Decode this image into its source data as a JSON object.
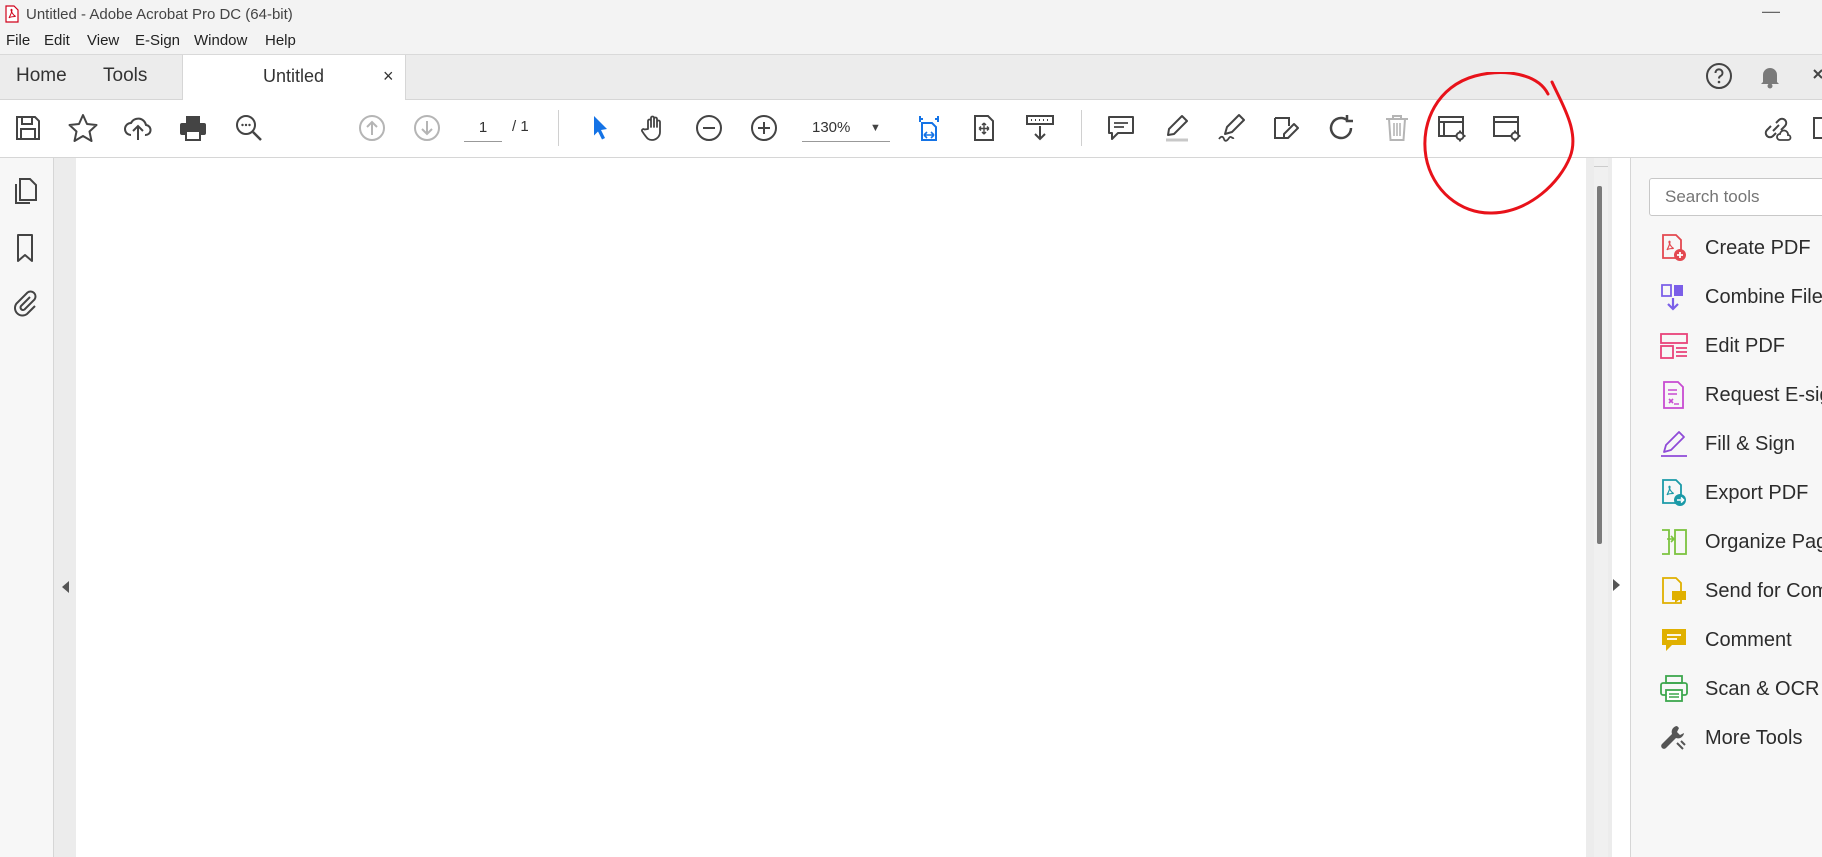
{
  "window": {
    "title": "Untitled - Adobe Acrobat Pro DC (64-bit)",
    "minimize_glyph": "—"
  },
  "menu": [
    "File",
    "Edit",
    "View",
    "E-Sign",
    "Window",
    "Help"
  ],
  "tabs": {
    "home": "Home",
    "tools": "Tools",
    "document": "Untitled",
    "close_glyph": "×"
  },
  "header_icons": [
    "help-icon",
    "notification-bell-icon"
  ],
  "toolbar": {
    "page_current": "1",
    "page_count": "/ 1",
    "zoom": "130%",
    "zoom_dropdown_glyph": "▼",
    "accent_color": "#1473e6"
  },
  "left_rail": [
    "page-thumbnails-icon",
    "bookmarks-icon",
    "attachments-icon"
  ],
  "right_panel": {
    "search_placeholder": "Search tools",
    "tools": [
      {
        "label": "Create PDF",
        "icon": "create-pdf-icon",
        "color": "#e34850"
      },
      {
        "label": "Combine Files",
        "icon": "combine-files-icon",
        "color": "#7b5fe8"
      },
      {
        "label": "Edit PDF",
        "icon": "edit-pdf-icon",
        "color": "#e8437a"
      },
      {
        "label": "Request E-signatures",
        "icon": "request-esign-icon",
        "color": "#c74bd1"
      },
      {
        "label": "Fill & Sign",
        "icon": "fill-sign-icon",
        "color": "#8f4bd8"
      },
      {
        "label": "Export PDF",
        "icon": "export-pdf-icon",
        "color": "#1b9aa8"
      },
      {
        "label": "Organize Pages",
        "icon": "organize-pages-icon",
        "color": "#7cc33f"
      },
      {
        "label": "Send for Comments",
        "icon": "send-comments-icon",
        "color": "#e0b000"
      },
      {
        "label": "Comment",
        "icon": "comment-icon",
        "color": "#e0b000"
      },
      {
        "label": "Scan & OCR",
        "icon": "scan-ocr-icon",
        "color": "#3da74e"
      },
      {
        "label": "More Tools",
        "icon": "more-tools-icon",
        "color": "#555555"
      }
    ]
  },
  "annotation_color": "#e8121a"
}
